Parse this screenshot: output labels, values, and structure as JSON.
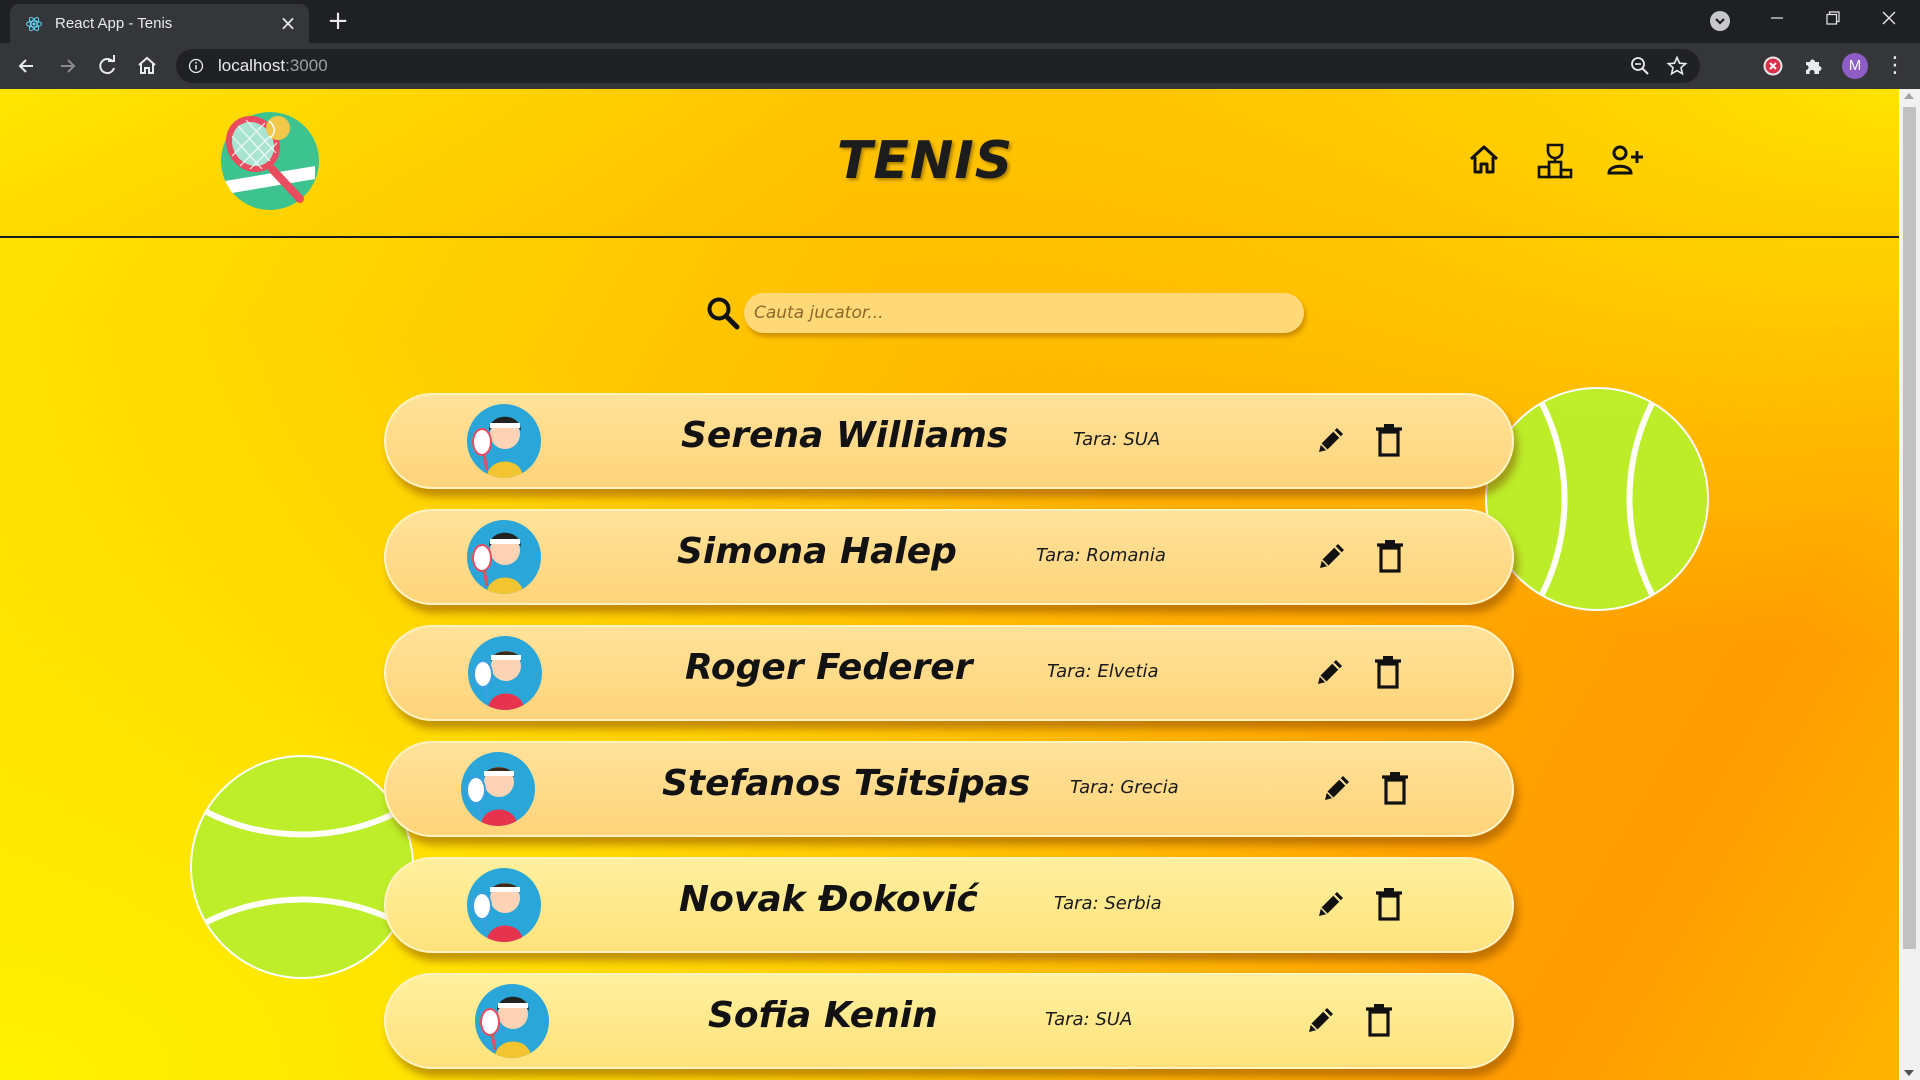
{
  "browser": {
    "tab_title": "React App - Tenis",
    "url_host": "localhost",
    "url_port": ":3000",
    "profile_initial": "M"
  },
  "app": {
    "title": "TENIS",
    "search_placeholder": "Cauta jucator..."
  },
  "players": [
    {
      "name": "Serena Williams",
      "country": "Tara: SUA",
      "shirt": "yellow"
    },
    {
      "name": "Simona Halep",
      "country": "Tara: Romania",
      "shirt": "yellow"
    },
    {
      "name": "Roger Federer",
      "country": "Tara: Elvetia",
      "shirt": "red"
    },
    {
      "name": "Stefanos Tsitsipas",
      "country": "Tara: Grecia",
      "shirt": "red"
    },
    {
      "name": "Novak Đoković",
      "country": "Tara: Serbia",
      "shirt": "red"
    },
    {
      "name": "Sofia Kenin",
      "country": "Tara: SUA",
      "shirt": "yellow"
    }
  ],
  "icons": {
    "nav": [
      "home-icon",
      "podium-icon",
      "add-user-icon"
    ],
    "row": [
      "edit-icon",
      "delete-icon"
    ]
  },
  "colors": {
    "page_gradient_start": "#ffe600",
    "page_gradient_end": "#ff9c00",
    "card": "#ffd87a",
    "ball": "#bcef2a"
  }
}
